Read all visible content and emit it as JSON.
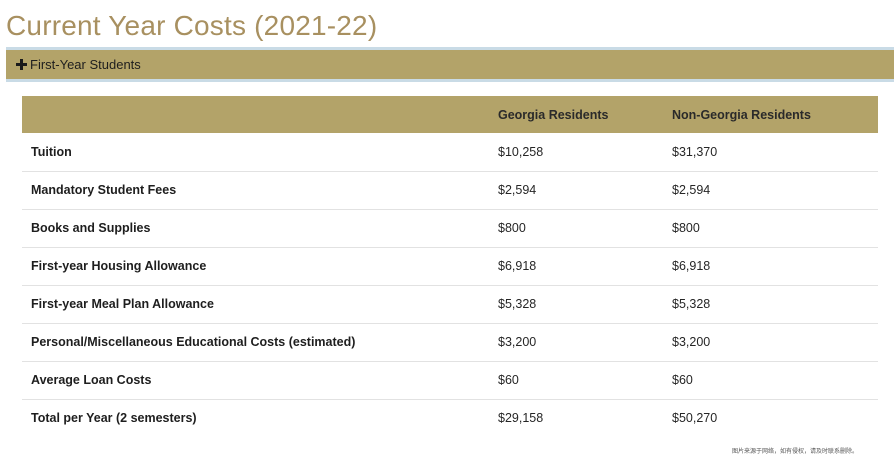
{
  "page": {
    "title": "Current Year Costs (2021-22)",
    "accent_color": "#b3a369",
    "title_color": "#a89060"
  },
  "accordion": {
    "icon": "plus-icon",
    "label": "First-Year Students",
    "expanded": true
  },
  "table": {
    "headers": [
      "",
      "Georgia Residents",
      "Non-Georgia Residents"
    ],
    "rows": [
      {
        "label": "Tuition",
        "georgia": "$10,258",
        "non_georgia": "$31,370"
      },
      {
        "label": "Mandatory Student Fees",
        "georgia": "$2,594",
        "non_georgia": "$2,594"
      },
      {
        "label": "Books and Supplies",
        "georgia": "$800",
        "non_georgia": "$800"
      },
      {
        "label": "First-year Housing Allowance",
        "georgia": "$6,918",
        "non_georgia": "$6,918"
      },
      {
        "label": "First-year Meal Plan Allowance",
        "georgia": "$5,328",
        "non_georgia": "$5,328"
      },
      {
        "label": "Personal/Miscellaneous Educational Costs (estimated)",
        "georgia": "$3,200",
        "non_georgia": "$3,200"
      },
      {
        "label": "Average Loan Costs",
        "georgia": "$60",
        "non_georgia": "$60"
      },
      {
        "label": "Total per Year (2 semesters)",
        "georgia": "$29,158",
        "non_georgia": "$50,270"
      }
    ]
  },
  "watermark": "图片来源于网络，如有侵权，请及时联系删除。"
}
